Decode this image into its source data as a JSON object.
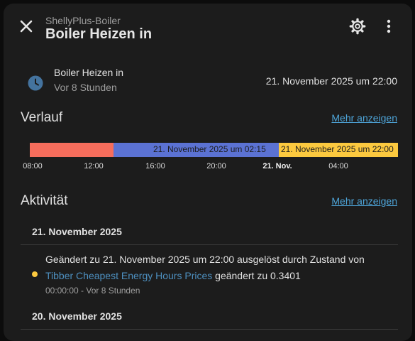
{
  "header": {
    "subtitle": "ShellyPlus-Boiler",
    "title": "Boiler Heizen in",
    "close_icon": "close-icon",
    "settings_icon": "gear-icon",
    "more_icon": "more-vertical-icon"
  },
  "state": {
    "icon": "clock-icon",
    "name": "Boiler Heizen in",
    "relative": "Vor 8 Stunden",
    "value": "21. November 2025 um 22:00"
  },
  "history": {
    "title": "Verlauf",
    "more_link": "Mehr anzeigen",
    "segment_colors": [
      "#f66d5c",
      "#5b72d3",
      "#fcc93f"
    ],
    "segment_labels": [
      "",
      "21. November 2025 um 02:15",
      "21. November 2025 um 22:00"
    ],
    "ticks": [
      {
        "label": "08:00",
        "bold": false
      },
      {
        "label": "12:00",
        "bold": false
      },
      {
        "label": "16:00",
        "bold": false
      },
      {
        "label": "20:00",
        "bold": false
      },
      {
        "label": "21. Nov.",
        "bold": true
      },
      {
        "label": "04:00",
        "bold": false
      }
    ]
  },
  "activity": {
    "title": "Aktivität",
    "more_link": "Mehr anzeigen",
    "days": [
      {
        "header": "21. November 2025",
        "entries": [
          {
            "dot_color": "#fcc93f",
            "line1": "Geändert zu 21. November 2025 um 22:00 ausgelöst durch Zustand von",
            "link": "Tibber Cheapest Energy Hours Prices",
            "after_link": " geändert zu 0.3401",
            "meta": "00:00:00 - Vor 8 Stunden"
          }
        ]
      },
      {
        "header": "20. November 2025",
        "entries": []
      }
    ]
  }
}
